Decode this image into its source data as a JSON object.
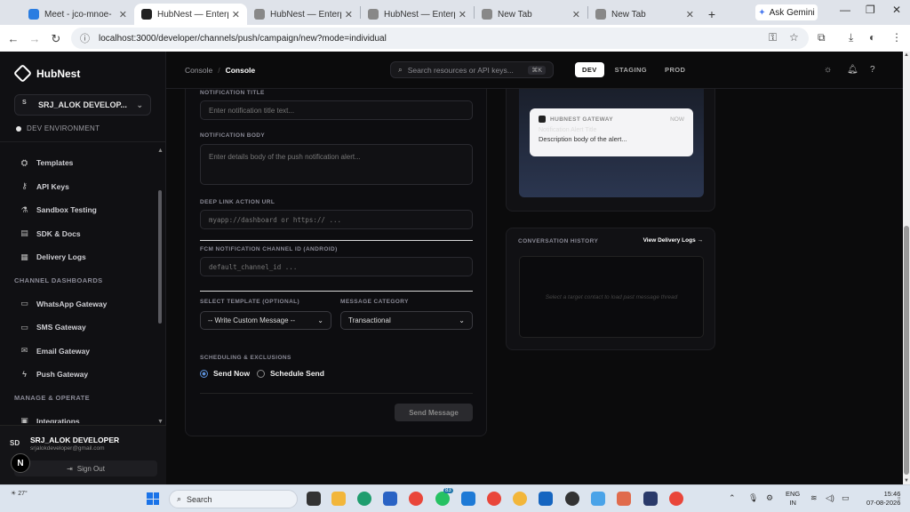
{
  "browser": {
    "tabs": [
      {
        "title": "Meet - jco-mnoe-",
        "fav": "#2a7de1",
        "icon": "meet-icon",
        "active": false
      },
      {
        "title": "HubNest — Enterprise",
        "fav": "#222",
        "icon": "globe-icon",
        "active": true
      },
      {
        "title": "HubNest — Enterprise",
        "fav": "#888",
        "icon": "globe-icon",
        "active": false
      },
      {
        "title": "HubNest — Enterprise",
        "fav": "#888",
        "icon": "globe-icon",
        "active": false
      },
      {
        "title": "New Tab",
        "fav": "#888",
        "icon": "globe-icon",
        "active": false
      },
      {
        "title": "New Tab",
        "fav": "#888",
        "icon": "globe-icon",
        "active": false
      }
    ],
    "gemini_label": "Ask Gemini",
    "url": "localhost:3000/developer/channels/push/campaign/new?mode=individual"
  },
  "sidebar": {
    "brand": "HubNest",
    "account": {
      "initial": "S",
      "name": "SRJ_ALOK DEVELOP..."
    },
    "environment": "DEV ENVIRONMENT",
    "items": [
      {
        "type": "item",
        "label": "Templates",
        "icon": "template-icon",
        "glyph": "⛭"
      },
      {
        "type": "item",
        "label": "API Keys",
        "icon": "key-icon",
        "glyph": "⚷"
      },
      {
        "type": "item",
        "label": "Sandbox Testing",
        "icon": "flask-icon",
        "glyph": "⚗"
      },
      {
        "type": "item",
        "label": "SDK & Docs",
        "icon": "book-icon",
        "glyph": "▤"
      },
      {
        "type": "item",
        "label": "Delivery Logs",
        "icon": "file-icon",
        "glyph": "▦"
      },
      {
        "type": "header",
        "label": "CHANNEL DASHBOARDS"
      },
      {
        "type": "item",
        "label": "WhatsApp Gateway",
        "icon": "chat-icon",
        "glyph": "▭"
      },
      {
        "type": "item",
        "label": "SMS Gateway",
        "icon": "sms-icon",
        "glyph": "▭"
      },
      {
        "type": "item",
        "label": "Email Gateway",
        "icon": "mail-icon",
        "glyph": "✉"
      },
      {
        "type": "item",
        "label": "Push Gateway",
        "icon": "lightning-icon",
        "glyph": "ϟ"
      },
      {
        "type": "header",
        "label": "MANAGE & OPERATE"
      },
      {
        "type": "item",
        "label": "Integrations",
        "icon": "plug-icon",
        "glyph": "▣"
      }
    ],
    "user": {
      "initials": "SD",
      "name": "SRJ_ALOK DEVELOPER",
      "email": "srjalokdeveloper@gmail.com"
    },
    "signout_label": "Sign Out"
  },
  "header": {
    "crumb_root": "Console",
    "crumb_current": "Console",
    "search_placeholder": "Search resources or API keys...",
    "search_kbd": "⌘K",
    "env_tabs": [
      {
        "label": "DEV",
        "active": true
      },
      {
        "label": "STAGING",
        "active": false
      },
      {
        "label": "PROD",
        "active": false
      }
    ]
  },
  "form": {
    "title_label": "NOTIFICATION TITLE",
    "title_placeholder": "Enter notification title text...",
    "body_label": "NOTIFICATION BODY",
    "body_placeholder": "Enter details body of the push notification alert...",
    "deeplink_label": "DEEP LINK ACTION URL",
    "deeplink_placeholder": "myapp://dashboard or https:// ...",
    "channel_label": "FCM NOTIFICATION CHANNEL ID (ANDROID)",
    "channel_placeholder": "default_channel_id ...",
    "template_label": "SELECT TEMPLATE (OPTIONAL)",
    "template_value": "-- Write Custom Message --",
    "category_label": "MESSAGE CATEGORY",
    "category_value": "Transactional",
    "schedule_label": "SCHEDULING & EXCLUSIONS",
    "send_now": "Send Now",
    "schedule_send": "Schedule Send",
    "send_button": "Send Message"
  },
  "preview": {
    "app_name": "HUBNEST GATEWAY",
    "time": "NOW",
    "title": "Notification Alert Title",
    "body": "Description body of the alert..."
  },
  "history": {
    "title": "CONVERSATION HISTORY",
    "link": "View Delivery Logs →",
    "empty": "Select a target contact to load past message thread"
  },
  "taskbar": {
    "weather": "27°",
    "search": "Search",
    "whatsapp_badge": "83",
    "lang_top": "ENG",
    "lang_bottom": "IN",
    "time": "15:46",
    "date": "07-08-2026"
  }
}
